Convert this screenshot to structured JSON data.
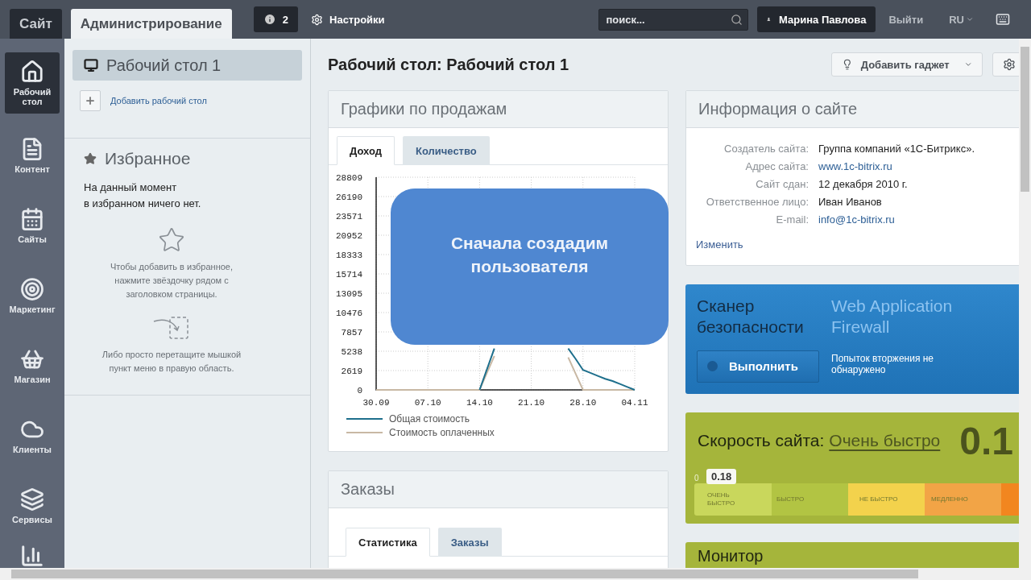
{
  "top_bar": {
    "tabs": [
      {
        "label": "Сайт",
        "selected": false
      },
      {
        "label": "Администрирование",
        "selected": true
      }
    ],
    "notifications": {
      "count": "2"
    },
    "settings": {
      "label": "Настройки"
    },
    "search": {
      "placeholder": "поиск..."
    },
    "user": {
      "name": "Марина Павлова"
    },
    "logout": {
      "label": "Выйти"
    },
    "language": {
      "label": "RU"
    }
  },
  "sidebar": {
    "items": [
      {
        "label": "Рабочий стол",
        "kind": "home",
        "selected": true
      },
      {
        "label": "Контент",
        "kind": "content",
        "selected": false
      },
      {
        "label": "Сайты",
        "kind": "sites",
        "selected": false
      },
      {
        "label": "Маркетинг",
        "kind": "marketing",
        "selected": false
      },
      {
        "label": "Магазин",
        "kind": "shop",
        "selected": false
      },
      {
        "label": "Клиенты",
        "kind": "clients",
        "selected": false
      },
      {
        "label": "Сервисы",
        "kind": "services",
        "selected": false
      }
    ]
  },
  "panel": {
    "desktops": [
      {
        "label": "Рабочий стол 1",
        "selected": true
      }
    ],
    "add_desktop": "Добавить рабочий стол",
    "favorites": {
      "title": "Избранное",
      "empty_lines": [
        "На данный момент",
        "в избранном ничего нет."
      ],
      "hints": [
        {
          "kind": "star",
          "text": "Чтобы добавить в избранное, нажмите звёздочку рядом с заголовком страницы."
        },
        {
          "kind": "drag",
          "text": "Либо просто перетащите мышкой пункт меню в правую область."
        }
      ]
    }
  },
  "main": {
    "title": "Рабочий стол: Рабочий стол 1",
    "add_gadget": "Добавить гаджет",
    "sales": {
      "title": "Графики по продажам",
      "tabs": [
        {
          "label": "Доход",
          "selected": true
        },
        {
          "label": "Количество",
          "selected": false
        }
      ],
      "chart_data": {
        "type": "line",
        "grid": true,
        "ylim": [
          0,
          28809
        ],
        "categories": [
          "30.09",
          null,
          null,
          null,
          null,
          null,
          null,
          "07.10",
          null,
          null,
          null,
          null,
          null,
          null,
          "14.10",
          null,
          null,
          null,
          null,
          null,
          null,
          "21.10",
          null,
          null,
          null,
          null,
          null,
          null,
          "28.10",
          null,
          null,
          null,
          null,
          null,
          null,
          "04.11"
        ],
        "yticks": [
          0,
          2619,
          5238,
          7857,
          10476,
          13095,
          15714,
          18333,
          20952,
          23571,
          26190,
          28809
        ],
        "series": [
          {
            "name": "Общая стоимость",
            "color": "#1e6f8c",
            "values": [
              null,
              null,
              null,
              null,
              null,
              null,
              null,
              null,
              null,
              null,
              null,
              null,
              null,
              null,
              0,
              2800,
              5600,
              null,
              null,
              null,
              null,
              null,
              null,
              null,
              null,
              null,
              5600,
              4200,
              2700,
              2300,
              1900,
              1500,
              1200,
              800,
              400,
              0
            ]
          },
          {
            "name": "Стоимость оплаченных",
            "color": "#c8b8a4",
            "values": [
              0,
              0,
              0,
              0,
              0,
              0,
              0,
              0,
              0,
              0,
              0,
              0,
              0,
              0,
              0,
              2300,
              4600,
              null,
              null,
              null,
              null,
              null,
              null,
              null,
              null,
              null,
              4400,
              2200,
              0,
              0,
              0,
              0,
              0,
              0,
              0,
              0
            ]
          }
        ]
      },
      "callout": "Сначала создадим пользователя"
    },
    "orders": {
      "title": "Заказы",
      "tabs": [
        {
          "label": "Статистика",
          "selected": true
        },
        {
          "label": "Заказы",
          "selected": false
        }
      ]
    },
    "site_info": {
      "title": "Информация о сайте",
      "rows": [
        {
          "label": "Создатель сайта:",
          "value": "Группа компаний «1С-Битрикс».",
          "kind": "text"
        },
        {
          "label": "Адрес сайта:",
          "value": "www.1c-bitrix.ru",
          "kind": "link"
        },
        {
          "label": "Сайт сдан:",
          "value": "12 декабря 2010 г.",
          "kind": "text"
        },
        {
          "label": "Ответственное лицо:",
          "value": "Иван Иванов",
          "kind": "text"
        },
        {
          "label": "E-mail:",
          "value": "info@1c-bitrix.ru",
          "kind": "link"
        }
      ],
      "edit": "Изменить"
    },
    "security": {
      "title": "Сканер безопасности",
      "firewall": "Web Application Firewall",
      "run": "Выполнить",
      "status": "Попыток вторжения не обнаружено"
    },
    "speed": {
      "title": "Скорость сайта:",
      "rating": "Очень быстро",
      "big_value": "0.1",
      "zero": "0",
      "marker": "0.18",
      "segments": [
        {
          "label": "ОЧЕНЬ БЫСТРО",
          "color": "#c9d75c"
        },
        {
          "label": "БЫСТРО",
          "color": "#b2c443"
        },
        {
          "label": "НЕ БЫСТРО",
          "color": "#f3d24c"
        },
        {
          "label": "МЕДЛЕННО",
          "color": "#f2a446"
        },
        {
          "color": "#f2861f"
        }
      ]
    },
    "monitor": {
      "title": "Монитор"
    }
  }
}
